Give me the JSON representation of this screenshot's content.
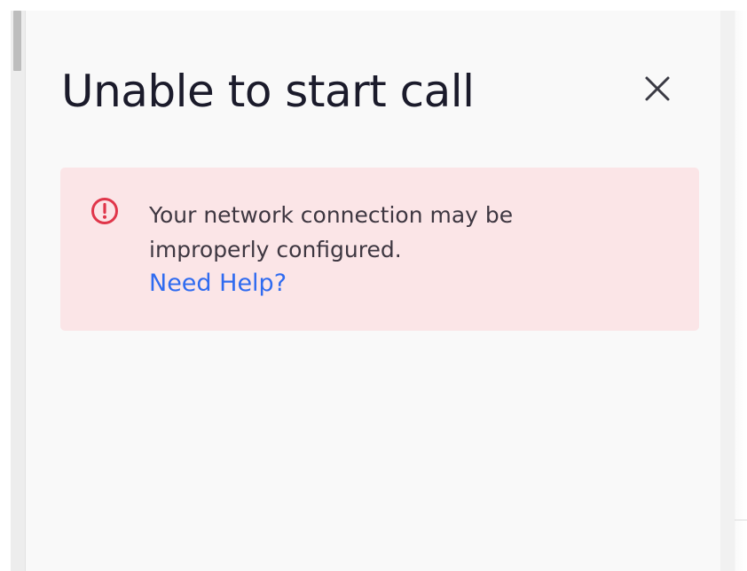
{
  "dialog": {
    "title": "Unable to start call",
    "close_icon": "close-icon"
  },
  "alert": {
    "icon": "error-circle-icon",
    "message_line1": "Your network connection may be",
    "message_line2": "improperly configured.",
    "help_link": "Need Help?",
    "colors": {
      "background": "#fbe5e7",
      "icon": "#e0364a",
      "text": "#3e3741",
      "link": "#2f6bf0"
    }
  }
}
